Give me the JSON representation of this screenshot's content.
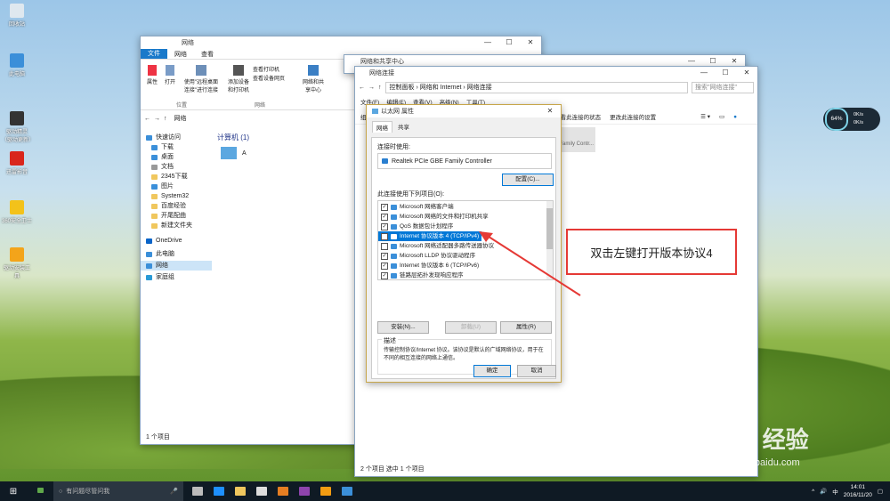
{
  "desktop": {
    "icons": [
      "回收站",
      "此电脑",
      "驱动精灵（驱动更新）",
      "迅雷影音",
      "360安全卫士",
      "驱动安装工具"
    ]
  },
  "explorer": {
    "title": "网络",
    "tabs": [
      "文件",
      "网络",
      "查看"
    ],
    "ribbon": {
      "buttons": [
        "属性",
        "打开",
        "使用\"远程桌面连接\"进行连接",
        "查看设备网页",
        "添加设备和打印机",
        "查看打印机",
        "查看设备网页",
        "网络和共享中心"
      ],
      "groups": [
        "位置",
        "网络"
      ]
    },
    "address": "网络",
    "nav": {
      "quick_access": "快速访问",
      "items": [
        "下载",
        "桌面",
        "文档",
        "2345下载",
        "图片",
        "System32",
        "百度经验",
        "开尾配曲",
        "新建文件夹"
      ],
      "onedrive": "OneDrive",
      "this_pc": "此电脑",
      "network": "网络",
      "homegroup": "家庭组"
    },
    "section_title": "计算机 (1)",
    "computer": "A",
    "status": "1 个项目"
  },
  "nsc": {
    "title": "网络和共享中心"
  },
  "netconn": {
    "title": "网络连接",
    "breadcrumb": [
      "控制面板",
      "网络和 Internet",
      "网络连接"
    ],
    "search_placeholder": "搜索\"网络连接\"",
    "menu": [
      "文件(F)",
      "编辑(E)",
      "查看(V)",
      "高级(N)",
      "工具(T)"
    ],
    "toolbar": [
      "组织 ▾",
      "禁用此网络设备",
      "诊断这个连接",
      "重命名此连接",
      "查看此连接的状态",
      "更改此连接的设置"
    ],
    "adapter_label": "Family Contr...",
    "status": "2 个项目  选中 1 个项目"
  },
  "dialog": {
    "title": "以太网 属性",
    "tabs": [
      "网络",
      "共享"
    ],
    "connect_using_label": "连接时使用:",
    "adapter": "Realtek PCIe GBE Family Controller",
    "configure": "配置(C)...",
    "items_label": "此连接使用下列项目(O):",
    "items": [
      {
        "label": "Microsoft 网络客户端",
        "checked": true
      },
      {
        "label": "Microsoft 网络的文件和打印机共享",
        "checked": true
      },
      {
        "label": "QoS 数据包计划程序",
        "checked": true
      },
      {
        "label": "Internet 协议版本 4 (TCP/IPv4)",
        "checked": true,
        "selected": true
      },
      {
        "label": "Microsoft 网络适配器多路传送器协议",
        "checked": false
      },
      {
        "label": "Microsoft LLDP 协议驱动程序",
        "checked": true
      },
      {
        "label": "Internet 协议版本 6 (TCP/IPv6)",
        "checked": true
      },
      {
        "label": "链路层拓扑发现响应程序",
        "checked": true
      }
    ],
    "install": "安装(N)...",
    "uninstall": "卸载(U)",
    "properties": "属性(R)",
    "desc_label": "描述",
    "description": "传输控制协议/Internet 协议。该协议是默认的广域网络协议，用于在不同的相互连接的网络上通信。",
    "ok": "确定",
    "cancel": "取消"
  },
  "annotation": {
    "text": "双击左键打开版本协议4",
    "color": "#e53935"
  },
  "widget": {
    "percent": "64%",
    "up": "0K/s",
    "down": "0K/s"
  },
  "watermark": {
    "brand": "Bai du 经验",
    "url": "jingyan.baidu.com"
  },
  "taskbar": {
    "search_placeholder": "有问题尽管问我",
    "time": "14:01",
    "date": "2016/11/20",
    "ime": "中"
  }
}
